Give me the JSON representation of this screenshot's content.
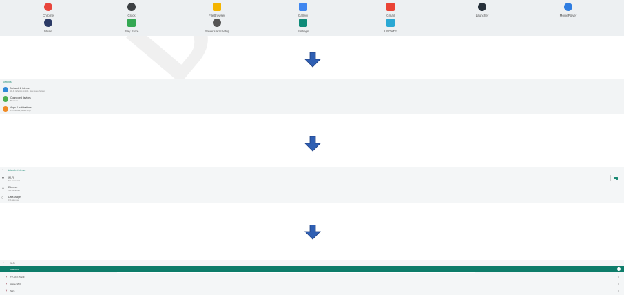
{
  "drawer": {
    "apps_row1": [
      {
        "label": "Chrome",
        "icon": "chrome-icon",
        "color": "#e8453c"
      },
      {
        "label": "Clock",
        "icon": "clock-icon",
        "color": "#3c4043"
      },
      {
        "label": "FileBrowser",
        "icon": "folder-icon",
        "color": "#f4b400"
      },
      {
        "label": "Gallery",
        "icon": "gallery-icon",
        "color": "#3f86f0"
      },
      {
        "label": "Gmail",
        "icon": "gmail-icon",
        "color": "#ea4335"
      },
      {
        "label": "Launcher",
        "icon": "launcher-icon",
        "color": "#26303a"
      },
      {
        "label": "MoviePlayer",
        "icon": "movieplayer-icon",
        "color": "#2f7de1"
      }
    ],
    "apps_row2": [
      {
        "label": "Music",
        "icon": "music-icon",
        "color": "#2b3a66"
      },
      {
        "label": "Play Store",
        "icon": "playstore-icon",
        "color": "#34a853"
      },
      {
        "label": "PowerAlarmSetup",
        "icon": "alarm-icon",
        "color": "#555555"
      },
      {
        "label": "Settings",
        "icon": "settings-icon",
        "color": "#0f8b79"
      },
      {
        "label": "UPDATE",
        "icon": "update-icon",
        "color": "#2aa8d4"
      }
    ]
  },
  "settings": {
    "header": "Settings",
    "items": [
      {
        "title": "Network & internet",
        "subtitle": "Wi-Fi, Ethernet, mobile, data usage, hotspot",
        "color": "#2f89d8"
      },
      {
        "title": "Connected devices",
        "subtitle": "Bluetooth",
        "color": "#4caf50"
      },
      {
        "title": "Apps & notifications",
        "subtitle": "Permissions, default apps",
        "color": "#f08a24"
      }
    ]
  },
  "network": {
    "title": "Network & internet",
    "items": [
      {
        "title": "Wi-Fi",
        "subtitle": "Not connected",
        "icon": "wifi-icon"
      },
      {
        "title": "Ethernet",
        "subtitle": "Not connected",
        "icon": "ethernet-icon"
      },
      {
        "title": "Data usage",
        "subtitle": "0 B data used",
        "icon": "data-usage-icon"
      }
    ]
  },
  "wifi": {
    "title": "Wi-Fi",
    "bar_label": "Use Wi-Fi",
    "networks": [
      "TP-LINK_5G3F",
      "Apple-WIFI",
      "SGS"
    ]
  },
  "watermark": "DNR"
}
